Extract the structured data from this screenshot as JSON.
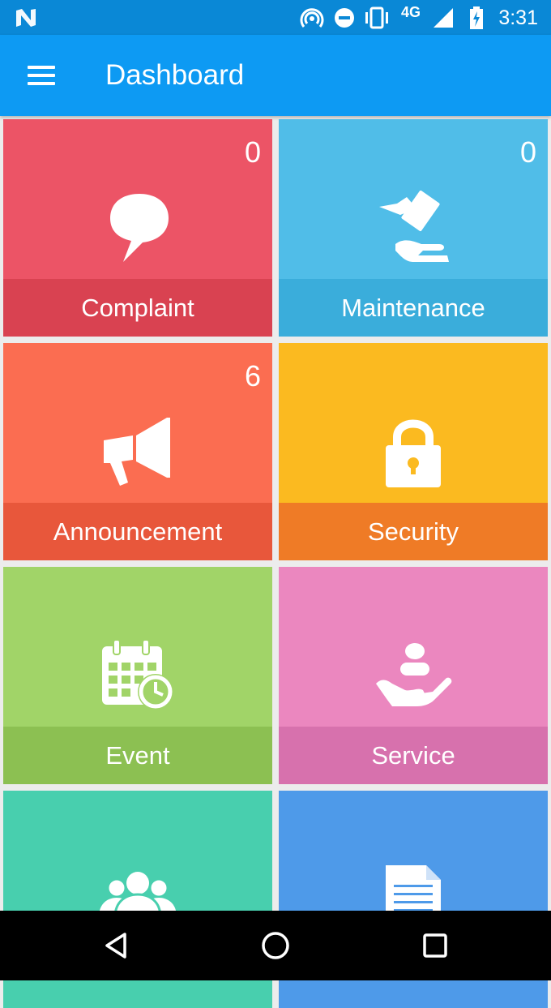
{
  "status_bar": {
    "network": "4G",
    "time": "3:31",
    "icons": [
      "n-logo-icon",
      "hotspot-icon",
      "do-not-disturb-icon",
      "vibrate-icon",
      "signal-icon",
      "battery-charging-icon"
    ]
  },
  "app_bar": {
    "title": "Dashboard",
    "menu_icon": "menu-icon"
  },
  "tiles": [
    {
      "label": "Complaint",
      "count": "0",
      "icon": "speech-bubble-icon",
      "color": "#ec5466",
      "band_color": "#d94251"
    },
    {
      "label": "Maintenance",
      "count": "0",
      "icon": "hand-bill-icon",
      "color": "#50bde8",
      "band_color": "#3aaddb"
    },
    {
      "label": "Announcement",
      "count": "6",
      "icon": "megaphone-icon",
      "color": "#fb6d51",
      "band_color": "#e8573b"
    },
    {
      "label": "Security",
      "count": "",
      "icon": "lock-icon",
      "color": "#fbba20",
      "band_color": "#ef7b26"
    },
    {
      "label": "Event",
      "count": "",
      "icon": "calendar-clock-icon",
      "color": "#a1d468",
      "band_color": "#8cc052"
    },
    {
      "label": "Service",
      "count": "",
      "icon": "service-hand-icon",
      "color": "#eb87bf",
      "band_color": "#d771ad"
    },
    {
      "label": "",
      "count": "",
      "icon": "group-icon",
      "color": "#48cfae",
      "band_color": "#38bb9a"
    },
    {
      "label": "",
      "count": "",
      "icon": "document-icon",
      "color": "#4e9ae9",
      "band_color": "#3f89d8"
    }
  ],
  "nav_bar": {
    "buttons": [
      "back-icon",
      "home-icon",
      "recents-icon"
    ]
  }
}
